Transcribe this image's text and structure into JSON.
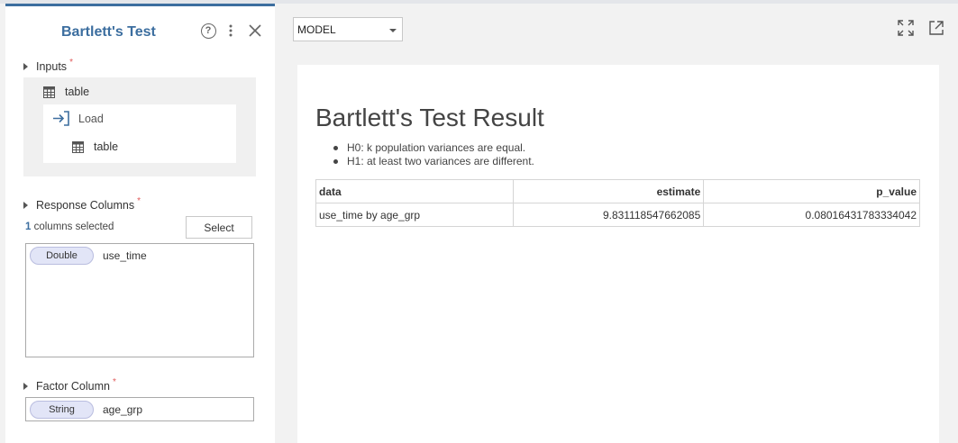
{
  "panel": {
    "title": "Bartlett's Test",
    "inputs": {
      "label": "Inputs",
      "required_mark": "*",
      "table_label": "table",
      "load_label": "Load",
      "load_table_label": "table"
    },
    "response_columns": {
      "label": "Response Columns",
      "required_mark": "*",
      "selected_count": "1",
      "selected_suffix": " columns selected",
      "select_button": "Select",
      "columns": [
        {
          "type": "Double",
          "name": "use_time"
        }
      ]
    },
    "factor_column": {
      "label": "Factor Column",
      "required_mark": "*",
      "column": {
        "type": "String",
        "name": "age_grp"
      }
    }
  },
  "toolbar": {
    "model_select_value": "MODEL"
  },
  "result": {
    "title": "Bartlett's Test Result",
    "hypotheses": [
      "H0: k population variances are equal.",
      "H1: at least two variances are different."
    ],
    "table": {
      "headers": [
        "data",
        "estimate",
        "p_value"
      ],
      "rows": [
        [
          "use_time by age_grp",
          "9.831118547662085",
          "0.08016431783334042"
        ]
      ]
    }
  },
  "colors": {
    "accent": "#3c6e9f",
    "required": "#e05a5a",
    "pill_bg": "#e2e5f7"
  }
}
